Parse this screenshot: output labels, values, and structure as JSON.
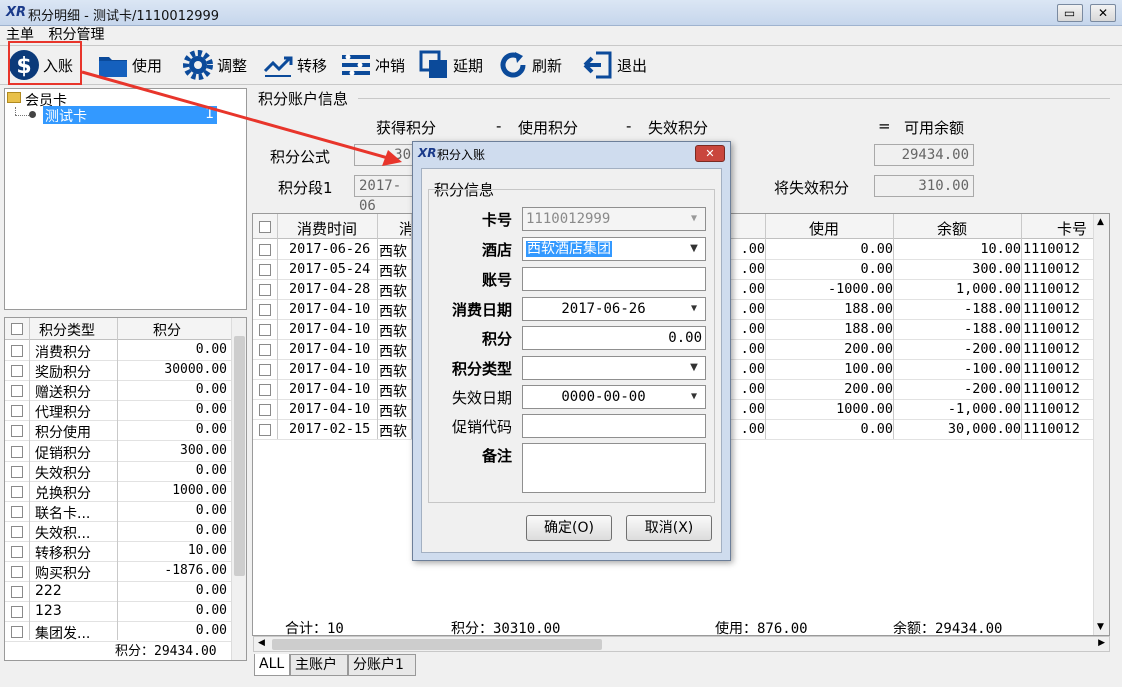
{
  "window": {
    "app_icon": "XR",
    "title": "积分明细 - 测试卡/1110012999",
    "buttons": [
      "▭",
      "✕"
    ]
  },
  "menu": [
    "主单",
    "积分管理"
  ],
  "toolbar": [
    {
      "label": "入账",
      "icon": "dollar-icon"
    },
    {
      "label": "使用",
      "icon": "folder-icon"
    },
    {
      "label": "调整",
      "icon": "gear-icon"
    },
    {
      "label": "转移",
      "icon": "transfer-icon"
    },
    {
      "label": "冲销",
      "icon": "list-icon"
    },
    {
      "label": "延期",
      "icon": "window-icon"
    },
    {
      "label": "刷新",
      "icon": "refresh-icon"
    },
    {
      "label": "退出",
      "icon": "exit-icon"
    }
  ],
  "tree": {
    "root": "会员卡",
    "child": "测试卡",
    "child_count": "1"
  },
  "points_type_table": {
    "headers": [
      "积分类型",
      "积分"
    ],
    "rows": [
      [
        "消费积分",
        "0.00"
      ],
      [
        "奖励积分",
        "30000.00"
      ],
      [
        "赠送积分",
        "0.00"
      ],
      [
        "代理积分",
        "0.00"
      ],
      [
        "积分使用",
        "0.00"
      ],
      [
        "促销积分",
        "300.00"
      ],
      [
        "失效积分",
        "0.00"
      ],
      [
        "兑换积分",
        "1000.00"
      ],
      [
        "联名卡...",
        "0.00"
      ],
      [
        "失效积...",
        "0.00"
      ],
      [
        "转移积分",
        "10.00"
      ],
      [
        "购买积分",
        "-1876.00"
      ],
      [
        "222",
        "0.00"
      ],
      [
        "123",
        "0.00"
      ],
      [
        "集团发...",
        "0.00"
      ]
    ],
    "footer": "积分：29434.00"
  },
  "account_info": {
    "section_title": "积分账户信息",
    "col_earned": "获得积分",
    "minus1": "-",
    "col_used": "使用积分",
    "minus2": "-",
    "col_expired": "失效积分",
    "equals": "=",
    "col_available": "可用余额",
    "row1_label": "积分公式",
    "row1_value": "30",
    "row1_available": "29434.00",
    "row2_label": "积分段1",
    "row2_value": "2017-06",
    "row2_expiring_label": "将失效积分",
    "row2_expiring_value": "310.00"
  },
  "detail_grid": {
    "headers": [
      "消费时间",
      "消",
      "使用",
      "余额",
      "卡号"
    ],
    "rows": [
      [
        "2017-06-26",
        "西软",
        ".00",
        "0.00",
        "10.00",
        "1110012"
      ],
      [
        "2017-05-24",
        "西软",
        ".00",
        "0.00",
        "300.00",
        "1110012"
      ],
      [
        "2017-04-28",
        "西软",
        ".00",
        "-1000.00",
        "1,000.00",
        "1110012"
      ],
      [
        "2017-04-10",
        "西软",
        ".00",
        "188.00",
        "-188.00",
        "1110012"
      ],
      [
        "2017-04-10",
        "西软",
        ".00",
        "188.00",
        "-188.00",
        "1110012"
      ],
      [
        "2017-04-10",
        "西软",
        ".00",
        "200.00",
        "-200.00",
        "1110012"
      ],
      [
        "2017-04-10",
        "西软",
        ".00",
        "100.00",
        "-100.00",
        "1110012"
      ],
      [
        "2017-04-10",
        "西软",
        ".00",
        "200.00",
        "-200.00",
        "1110012"
      ],
      [
        "2017-04-10",
        "西软",
        ".00",
        "1000.00",
        "-1,000.00",
        "1110012"
      ],
      [
        "2017-02-15",
        "西软",
        ".00",
        "0.00",
        "30,000.00",
        "1110012"
      ]
    ],
    "summary": {
      "total": "合计：10",
      "points": "积分：30310.00",
      "used": "使用：876.00",
      "balance": "余额：29434.00"
    }
  },
  "tabs": [
    "ALL",
    "主账户",
    "分账户1"
  ],
  "dialog": {
    "title": "积分入账",
    "group_title": "积分信息",
    "card_no_label": "卡号",
    "card_no_value": "1110012999",
    "hotel_label": "酒店",
    "hotel_value": "西软酒店集团",
    "account_label": "账号",
    "account_value": "",
    "date_label": "消费日期",
    "date_value": "2017-06-26",
    "points_label": "积分",
    "points_value": "0.00",
    "points_type_label": "积分类型",
    "points_type_value": "",
    "expire_label": "失效日期",
    "expire_value": "0000-00-00",
    "promo_label": "促销代码",
    "promo_value": "",
    "remark_label": "备注",
    "remark_value": "",
    "ok_label": "确定(O)",
    "cancel_label": "取消(X)",
    "close_glyph": "✕"
  },
  "colors": {
    "annotation_red": "#e8352b",
    "selection_blue": "#3399ff"
  }
}
